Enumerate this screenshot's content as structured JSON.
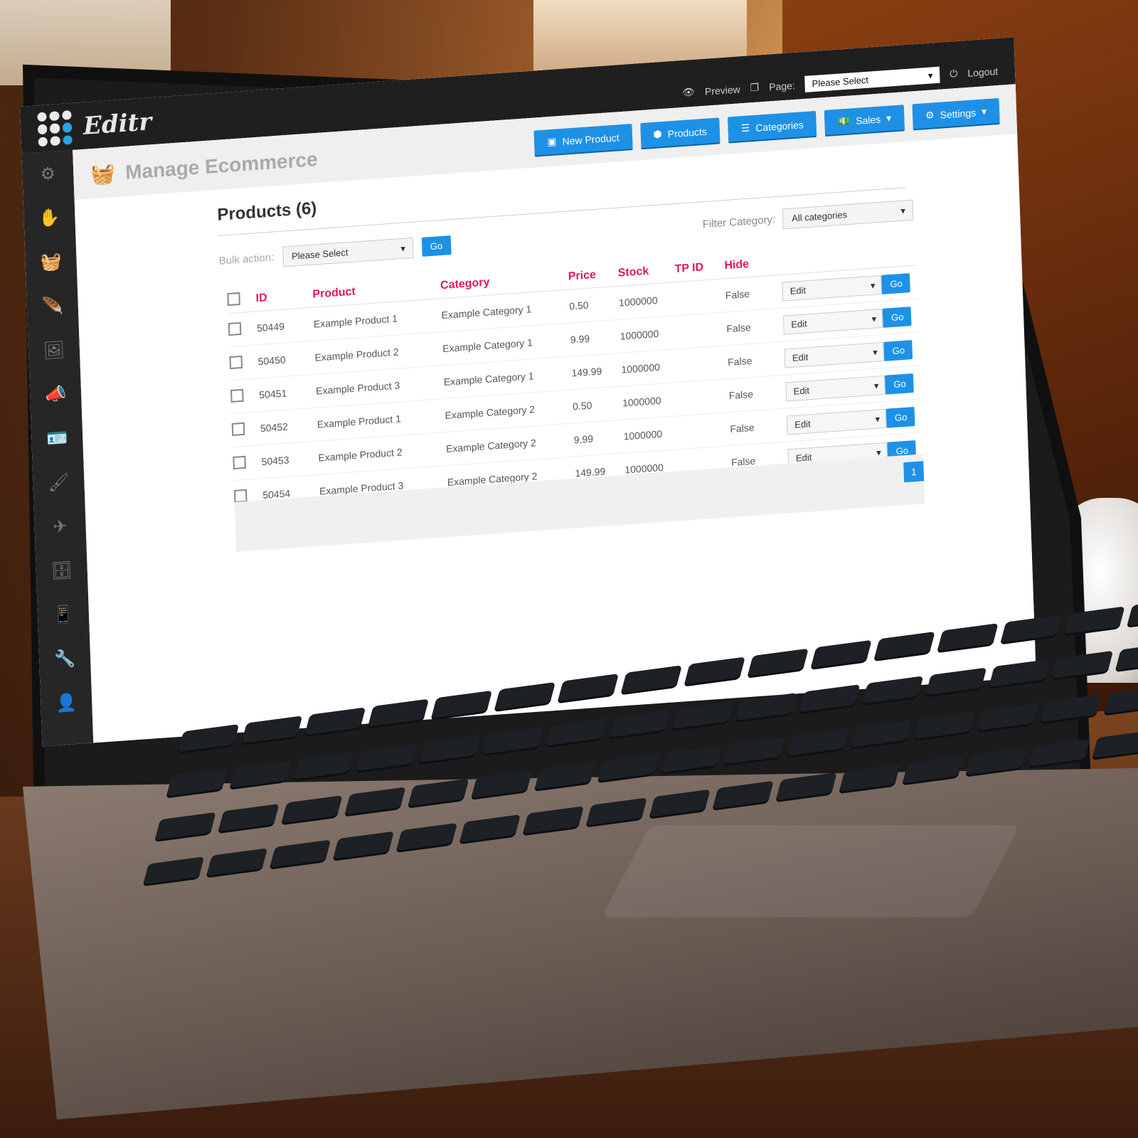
{
  "app": {
    "logo_text": "Editr"
  },
  "top_links": {
    "preview": "Preview",
    "page_label": "Page:",
    "page_select": "Please Select",
    "logout": "Logout"
  },
  "header": {
    "title": "Manage Ecommerce"
  },
  "buttons": {
    "new_product": "New Product",
    "products": "Products",
    "categories": "Categories",
    "sales": "Sales",
    "settings": "Settings"
  },
  "main": {
    "products_title": "Products (6)",
    "bulk_label": "Bulk action:",
    "bulk_select": "Please Select",
    "go": "Go",
    "filter_label": "Filter Category:",
    "filter_select": "All categories"
  },
  "table": {
    "columns": [
      "ID",
      "Product",
      "Category",
      "Price",
      "Stock",
      "TP ID",
      "Hide"
    ],
    "rows": [
      {
        "id": "50449",
        "product": "Example Product 1",
        "category": "Example Category 1",
        "price": "0.50",
        "stock": "1000000",
        "tp_id": "",
        "hide": "False",
        "action": "Edit"
      },
      {
        "id": "50450",
        "product": "Example Product 2",
        "category": "Example Category 1",
        "price": "9.99",
        "stock": "1000000",
        "tp_id": "",
        "hide": "False",
        "action": "Edit"
      },
      {
        "id": "50451",
        "product": "Example Product 3",
        "category": "Example Category 1",
        "price": "149.99",
        "stock": "1000000",
        "tp_id": "",
        "hide": "False",
        "action": "Edit"
      },
      {
        "id": "50452",
        "product": "Example Product 1",
        "category": "Example Category 2",
        "price": "0.50",
        "stock": "1000000",
        "tp_id": "",
        "hide": "False",
        "action": "Edit"
      },
      {
        "id": "50453",
        "product": "Example Product 2",
        "category": "Example Category 2",
        "price": "9.99",
        "stock": "1000000",
        "tp_id": "",
        "hide": "False",
        "action": "Edit"
      },
      {
        "id": "50454",
        "product": "Example Product 3",
        "category": "Example Category 2",
        "price": "149.99",
        "stock": "1000000",
        "tp_id": "",
        "hide": "False",
        "action": "Edit"
      }
    ]
  },
  "pagination": {
    "current": "1"
  },
  "colors": {
    "accent": "#1e91e6",
    "header_text": "#e2175c"
  },
  "icons": [
    "grid-logo-icon",
    "eye-icon",
    "page-icon",
    "power-icon",
    "basket-icon",
    "gear-icon",
    "hand-icon",
    "feather-icon",
    "image-icon",
    "megaphone-icon",
    "card-icon",
    "paint-roller-icon",
    "paper-plane-icon",
    "server-icon",
    "mobile-icon",
    "wrench-icon",
    "user-icon"
  ]
}
